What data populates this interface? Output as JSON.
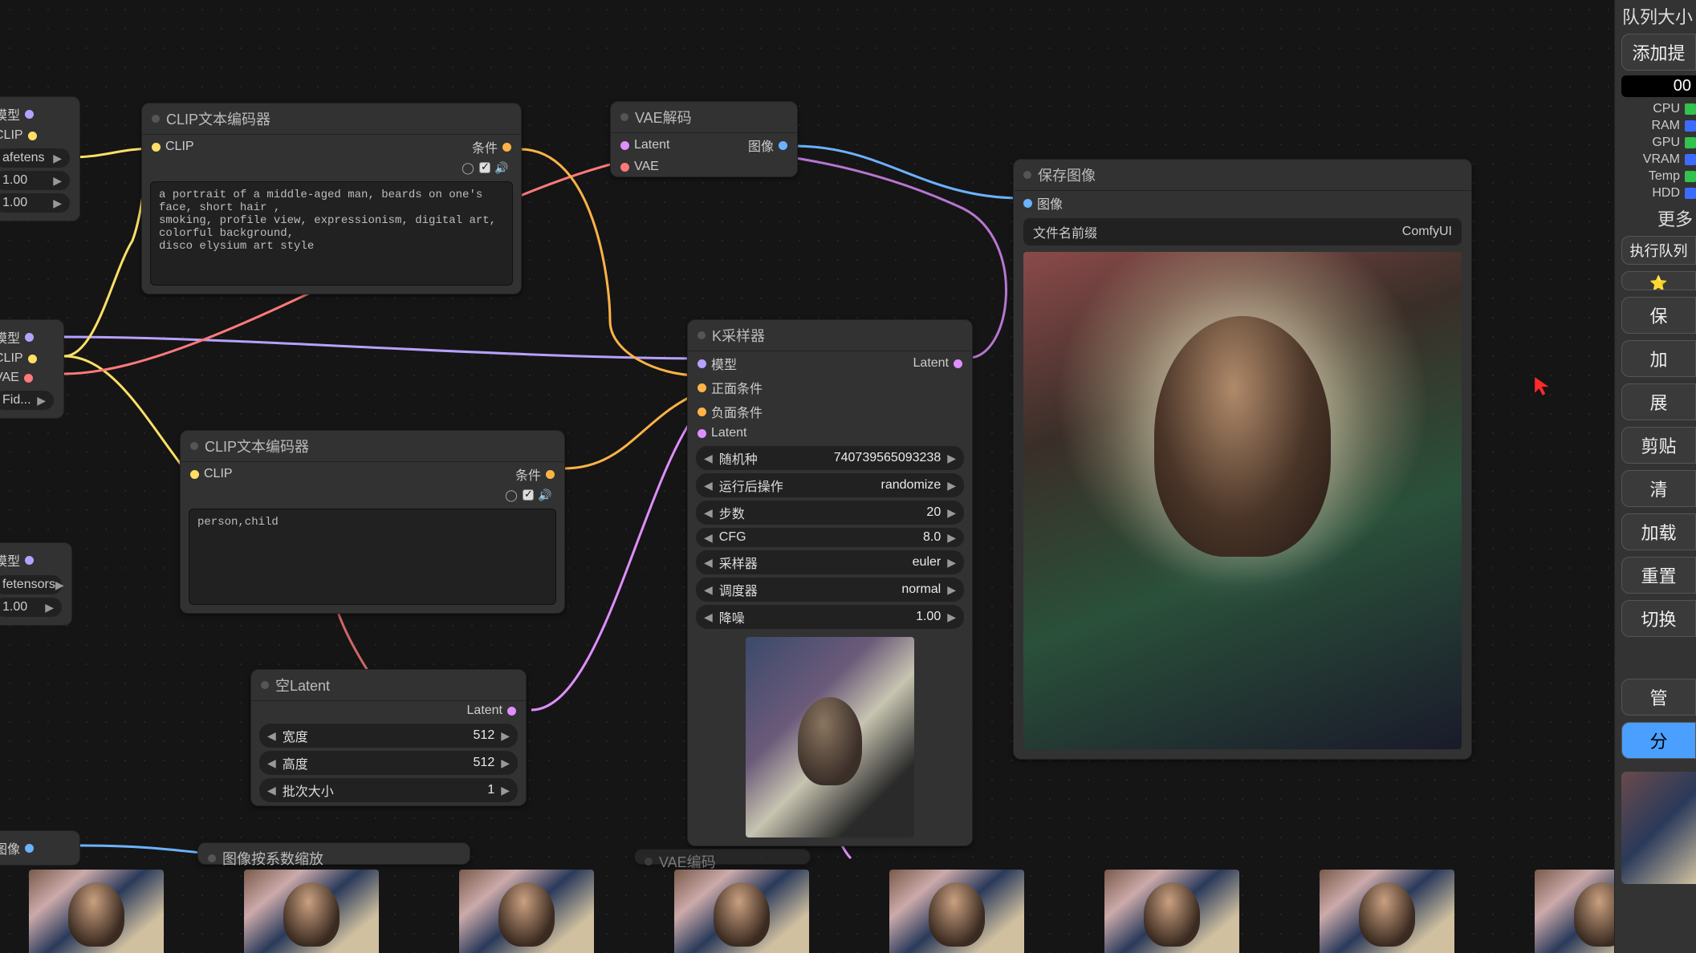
{
  "nodes": {
    "clip_pos": {
      "title": "CLIP文本编码器",
      "in_clip": "CLIP",
      "out_cond": "条件",
      "text": "a portrait of a middle-aged man, beards on one's face, short hair ,\nsmoking, profile view, expressionism, digital art, colorful background,\ndisco elysium art style"
    },
    "clip_neg": {
      "title": "CLIP文本编码器",
      "in_clip": "CLIP",
      "out_cond": "条件",
      "text": "person,child"
    },
    "vae_decode": {
      "title": "VAE解码",
      "in_latent": "Latent",
      "in_vae": "VAE",
      "out_image": "图像"
    },
    "ksampler": {
      "title": "K采样器",
      "in_model": "模型",
      "in_pos": "正面条件",
      "in_neg": "负面条件",
      "in_latent": "Latent",
      "out_latent": "Latent",
      "widgets": {
        "seed_label": "随机种",
        "seed_val": "740739565093238",
        "after_label": "运行后操作",
        "after_val": "randomize",
        "steps_label": "步数",
        "steps_val": "20",
        "cfg_label": "CFG",
        "cfg_val": "8.0",
        "sampler_label": "采样器",
        "sampler_val": "euler",
        "sched_label": "调度器",
        "sched_val": "normal",
        "denoise_label": "降噪",
        "denoise_val": "1.00"
      }
    },
    "empty_latent": {
      "title": "空Latent",
      "out_latent": "Latent",
      "width_label": "宽度",
      "width_val": "512",
      "height_label": "高度",
      "height_val": "512",
      "batch_label": "批次大小",
      "batch_val": "1"
    },
    "save_image": {
      "title": "保存图像",
      "in_image": "图像",
      "prefix_label": "文件名前缀",
      "prefix_val": "ComfyUI"
    },
    "scale_node": {
      "title": "图像按系数缩放"
    },
    "vae_encode2": {
      "title": "VAE编码"
    }
  },
  "stubs": {
    "top": {
      "model": "模型",
      "clip": "CLIP",
      "ckpt": "afetens",
      "v1": "1.00",
      "v2": "1.00"
    },
    "mid": {
      "model": "模型",
      "clip": "CLIP",
      "vae": "VAE",
      "file": "Fid..."
    },
    "low": {
      "model": "模型",
      "file": "fetensors",
      "v": "1.00"
    },
    "img": {
      "image": "图像"
    }
  },
  "sidebar": {
    "queue_label": "队列大小",
    "add_prompt": "添加提",
    "counter": "00",
    "meters": {
      "cpu": "CPU",
      "ram": "RAM",
      "gpu": "GPU",
      "vram": "VRAM",
      "temp": "Temp",
      "hdd": "HDD"
    },
    "more": "更多",
    "exec_queue": "执行队列",
    "btns": [
      "保",
      "加",
      "展",
      "剪贴",
      "清",
      "加载",
      "重置",
      "切换"
    ],
    "manage": "管",
    "run": "分"
  }
}
